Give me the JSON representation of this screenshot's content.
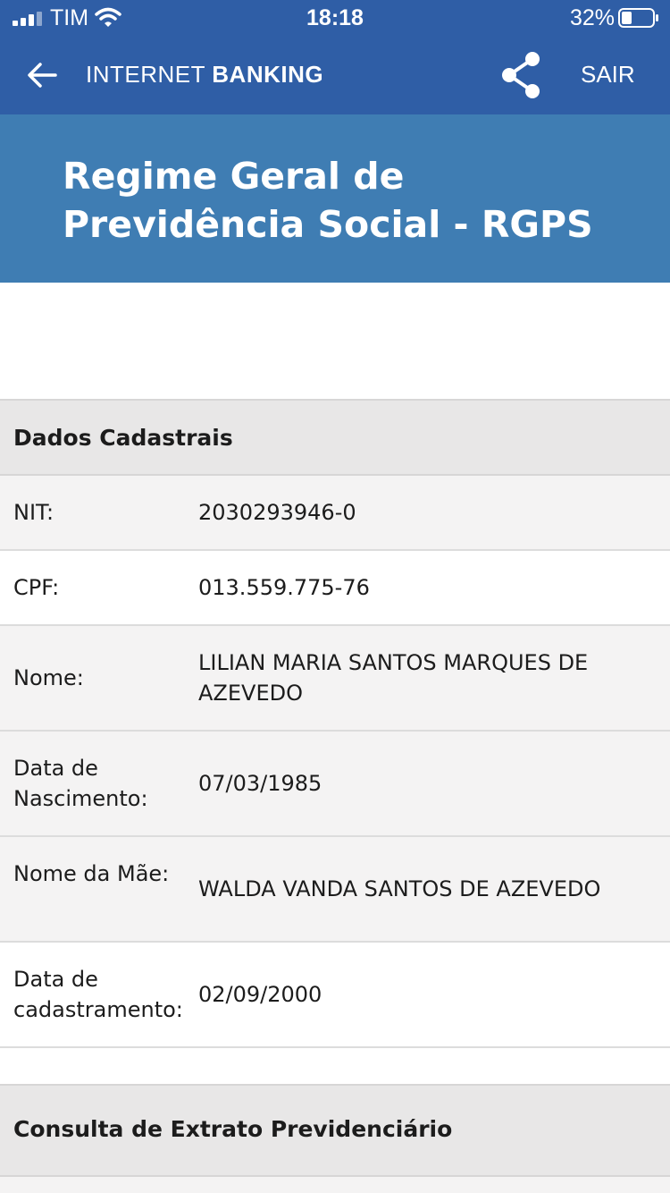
{
  "status_bar": {
    "carrier": "TIM",
    "time": "18:18",
    "battery_percent": "32%",
    "battery_level": 0.32,
    "signal_icon": "signal-bars-icon",
    "wifi_icon": "wifi-icon",
    "battery_icon": "battery-icon"
  },
  "header": {
    "title_light": "INTERNET ",
    "title_bold": "BANKING",
    "logout_label": "SAIR",
    "back_icon": "arrow-left-icon",
    "share_icon": "share-icon",
    "background_color": "#2f5ea6"
  },
  "banner": {
    "title": "Regime Geral de Previdência Social - RGPS",
    "background_color": "#3f7db3"
  },
  "sections": {
    "personal_data": {
      "title": "Dados Cadastrais",
      "rows": [
        {
          "label": "NIT:",
          "value": "2030293946-0"
        },
        {
          "label": "CPF:",
          "value": "013.559.775-76"
        },
        {
          "label": "Nome:",
          "value": "LILIAN MARIA SANTOS MARQUES DE AZEVEDO"
        },
        {
          "label": "Data de Nascimento:",
          "value": "07/03/1985"
        },
        {
          "label": "Nome da Mãe:",
          "value": "WALDA VANDA SANTOS DE AZEVEDO"
        },
        {
          "label": "Data de cadastramento:",
          "value": "02/09/2000"
        }
      ]
    },
    "statement": {
      "title": "Consulta de Extrato Previdenciário"
    }
  }
}
